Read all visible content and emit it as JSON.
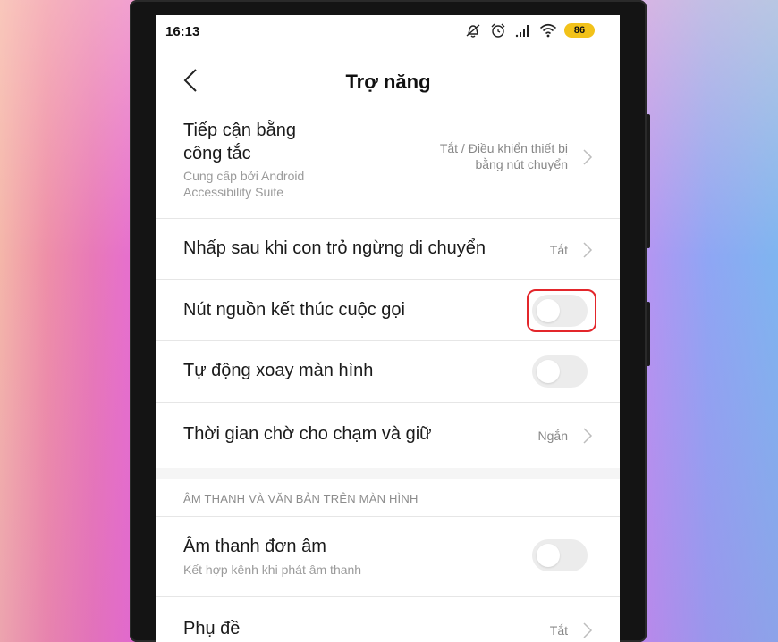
{
  "status_bar": {
    "time": "16:13",
    "icons": [
      "mute-icon",
      "alarm-icon",
      "signal-icon",
      "wifi-icon"
    ],
    "battery": "86",
    "battery_color": "#f2c21a"
  },
  "header": {
    "title": "Trợ năng",
    "back_icon": "chevron-left-icon"
  },
  "settings": {
    "switch_access": {
      "title_line1": "Tiếp cận bằng",
      "title_line2": "công tắc",
      "sub_line1": "Cung cấp bởi Android",
      "sub_line2": "Accessibility Suite",
      "value_line1": "Tắt / Điều khiển thiết bị",
      "value_line2": "bằng nút chuyển"
    },
    "click_after_stop": {
      "title": "Nhấp sau khi con trỏ ngừng di chuyển",
      "value": "Tắt"
    },
    "power_ends_call": {
      "title": "Nút nguồn kết thúc cuộc gọi",
      "toggle_on": false,
      "highlight_color": "#e3262b"
    },
    "auto_rotate": {
      "title": "Tự động xoay màn hình",
      "toggle_on": false
    },
    "touch_hold_delay": {
      "title": "Thời gian chờ cho chạm và giữ",
      "value": "Ngắn"
    }
  },
  "audio_section": {
    "header": "ÂM THANH VÀ VĂN BẢN TRÊN MÀN HÌNH",
    "mono_audio": {
      "title": "Âm thanh đơn âm",
      "sub": "Kết hợp kênh khi phát âm thanh",
      "toggle_on": false
    },
    "captions": {
      "title": "Phụ đề",
      "value": "Tắt"
    }
  }
}
